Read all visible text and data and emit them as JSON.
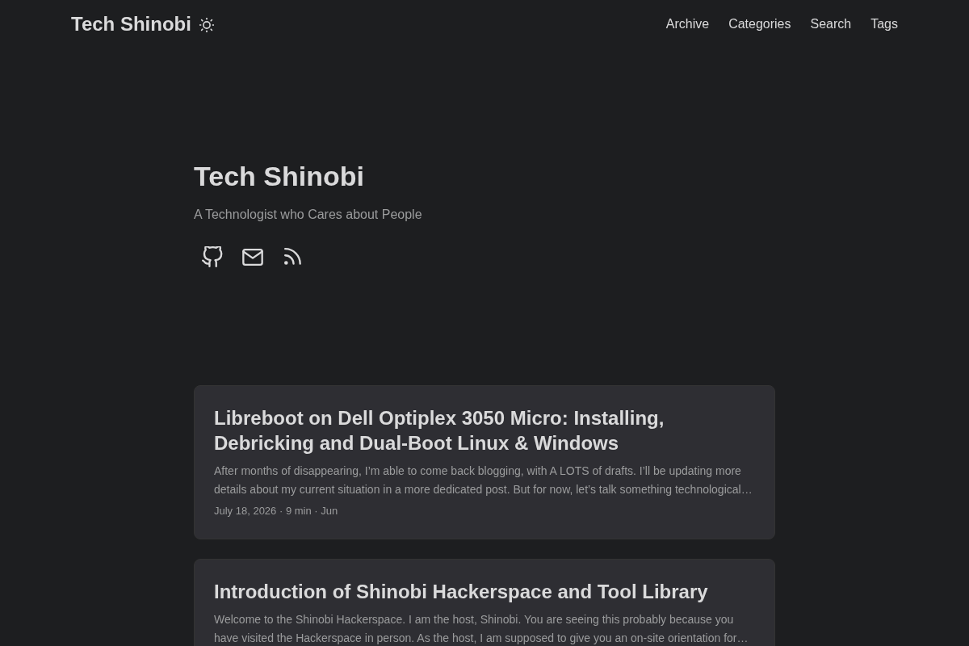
{
  "header": {
    "logo": "Tech Shinobi",
    "nav": [
      {
        "label": "Archive"
      },
      {
        "label": "Categories"
      },
      {
        "label": "Search"
      },
      {
        "label": "Tags"
      }
    ]
  },
  "hero": {
    "title": "Tech Shinobi",
    "subtitle": "A Technologist who Cares about People",
    "social_links": [
      {
        "kind": "github"
      },
      {
        "kind": "email"
      },
      {
        "kind": "rss"
      }
    ]
  },
  "posts": [
    {
      "title": "Libreboot on Dell Optiplex 3050 Micro: Installing, Debricking and Dual-Boot Linux & Windows",
      "excerpt": "After months of disappearing, I’m able to come back blogging, with A LOTS of drafts. I’ll be updating more details about my current situation in a more dedicated post. But for now, let’s talk something technological…",
      "meta": "July 18, 2026 · 9 min · Jun"
    },
    {
      "title": "Introduction of Shinobi Hackerspace and Tool Library",
      "excerpt": "Welcome to the Shinobi Hackerspace. I am the host, Shinobi. You are seeing this probably because you have visited the Hackerspace in person. As the host, I am supposed to give you an on-site orientation for…"
    }
  ]
}
